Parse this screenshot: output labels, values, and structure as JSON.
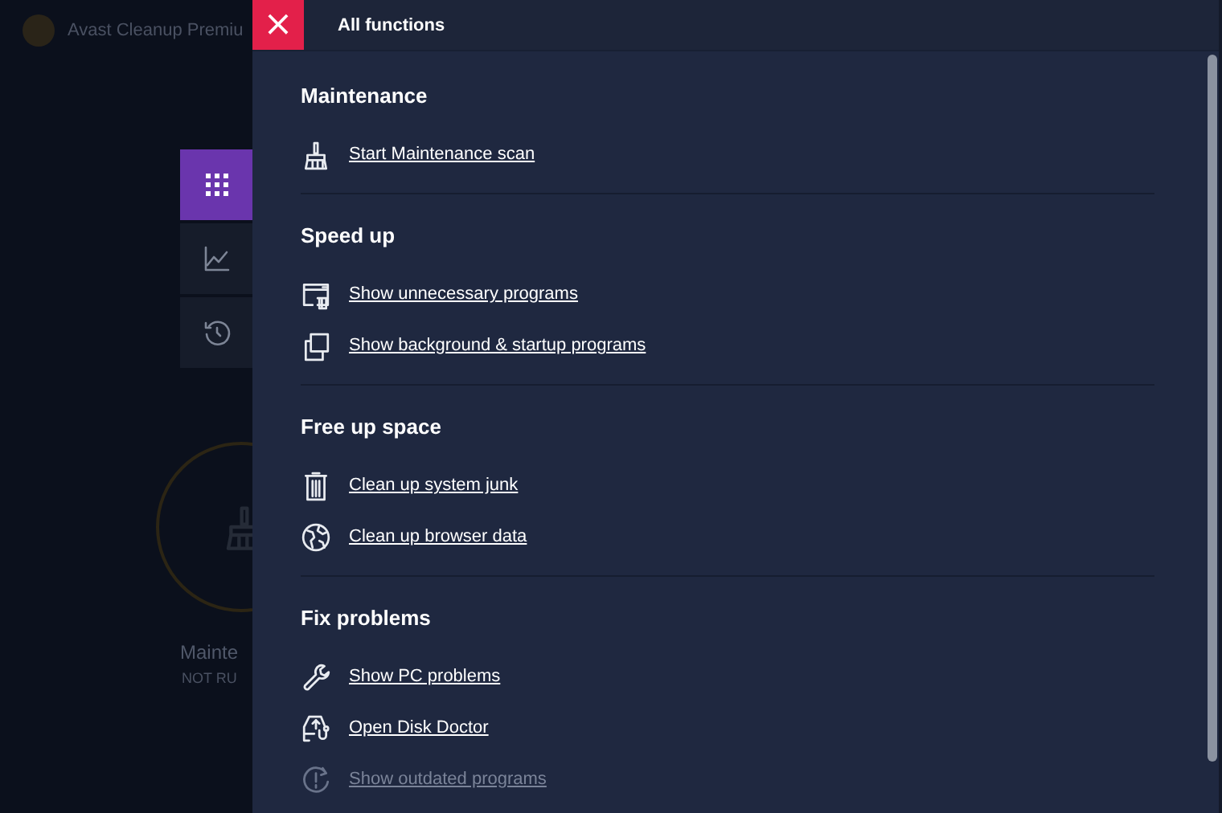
{
  "background": {
    "app_title": "Avast Cleanup Premiu",
    "status_title": "Mainte",
    "status_subtitle": "NOT RU"
  },
  "nav": [
    {
      "kind": "grid",
      "selected": true
    },
    {
      "kind": "chart",
      "selected": false
    },
    {
      "kind": "history",
      "selected": false
    }
  ],
  "panel": {
    "close": "×",
    "title": "All functions"
  },
  "sections": [
    {
      "heading": "Maintenance",
      "items": [
        {
          "kind": "brush",
          "label": "Start Maintenance scan",
          "disabled": false
        }
      ]
    },
    {
      "heading": "Speed up",
      "items": [
        {
          "kind": "window-trash",
          "label": "Show unnecessary programs",
          "disabled": false
        },
        {
          "kind": "copy",
          "label": "Show background & startup programs",
          "disabled": false
        }
      ]
    },
    {
      "heading": "Free up space",
      "items": [
        {
          "kind": "trash",
          "label": "Clean up system junk",
          "disabled": false
        },
        {
          "kind": "globe",
          "label": "Clean up browser data",
          "disabled": false
        }
      ]
    },
    {
      "heading": "Fix problems",
      "items": [
        {
          "kind": "wrench",
          "label": "Show PC problems",
          "disabled": false
        },
        {
          "kind": "disk",
          "label": "Open Disk Doctor",
          "disabled": false
        },
        {
          "kind": "alert",
          "label": "Show outdated programs",
          "disabled": true
        }
      ]
    }
  ]
}
